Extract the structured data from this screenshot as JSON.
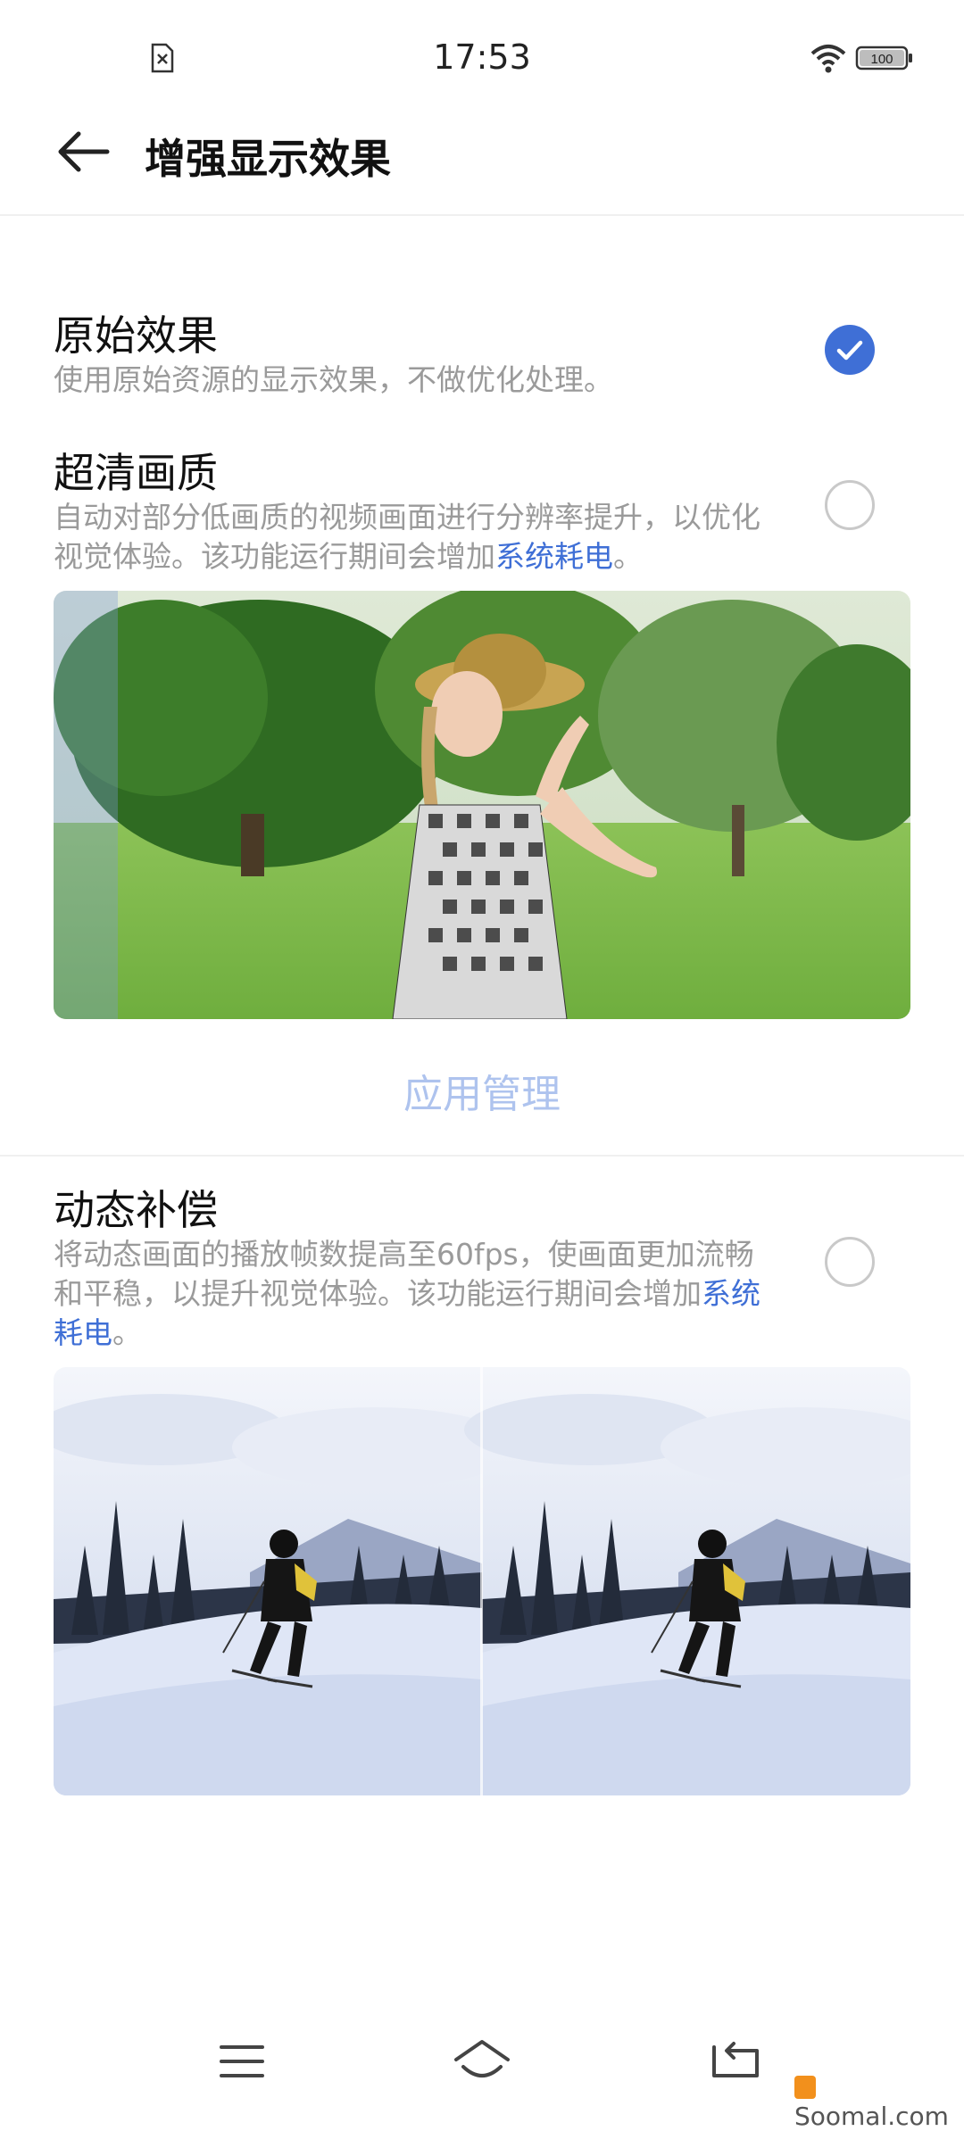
{
  "status_bar": {
    "time": "17:53",
    "battery": "100"
  },
  "header": {
    "title": "增强显示效果"
  },
  "options": [
    {
      "title": "原始效果",
      "desc": "使用原始资源的显示效果，不做优化处理。",
      "selected": true
    },
    {
      "title": "超清画质",
      "desc_before": "自动对部分低画质的视频画面进行分辨率提升，以优化视觉体验。该功能运行期间会增加",
      "link": "系统耗电",
      "desc_after": "。",
      "selected": false
    },
    {
      "title": "动态补偿",
      "desc_before": "将动态画面的播放帧数提高至60fps，使画面更加流畅和平稳，以提升视觉体验。该功能运行期间会增加",
      "link": "系统耗电",
      "desc_after": "。",
      "selected": false
    }
  ],
  "app_management": "应用管理",
  "watermark": "Soomal.com",
  "icons": {
    "back": "back-arrow-icon",
    "sim": "no-sim-icon",
    "wifi": "wifi-icon",
    "battery": "battery-icon",
    "menu": "menu-icon",
    "home": "home-icon",
    "return": "return-icon"
  },
  "colors": {
    "accent": "#3f6fd6",
    "link_disabled": "#aec3ee"
  }
}
